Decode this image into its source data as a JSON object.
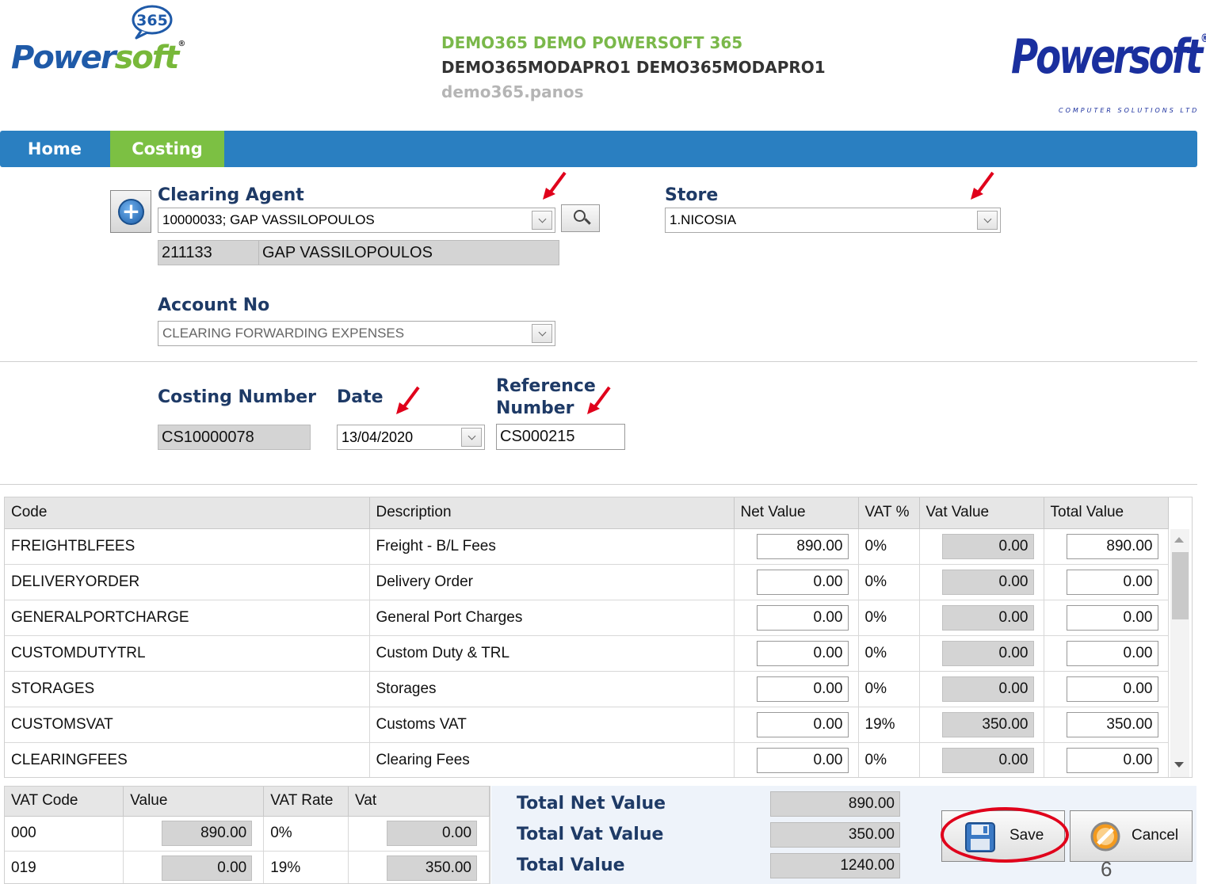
{
  "header": {
    "logo_left_text_a": "Power",
    "logo_left_text_b": "soft",
    "logo_left_badge": "365",
    "company_line": "DEMO365 DEMO POWERSOFT 365",
    "database_line": "DEMO365MODAPRO1 DEMO365MODAPRO1",
    "user_line": "demo365.panos",
    "logo_right_text": "Powersoft",
    "logo_right_subtitle": "COMPUTER SOLUTIONS LTD"
  },
  "nav": {
    "tabs": [
      {
        "label": "Home",
        "active": false
      },
      {
        "label": "Costing",
        "active": true
      }
    ]
  },
  "form": {
    "clearing_agent_label": "Clearing Agent",
    "clearing_agent_value": "10000033; GAP VASSILOPOULOS",
    "agent_code": "211133",
    "agent_name": "GAP VASSILOPOULOS",
    "store_label": "Store",
    "store_value": "1.NICOSIA",
    "account_no_label": "Account No",
    "account_no_value": "CLEARING  FORWARDING EXPENSES",
    "costing_number_label": "Costing Number",
    "costing_number_value": "CS10000078",
    "date_label": "Date",
    "date_value": "13/04/2020",
    "reference_label_1": "Reference",
    "reference_label_2": "Number",
    "reference_value": "CS000215"
  },
  "grid": {
    "columns": [
      "Code",
      "Description",
      "Net Value",
      "VAT %",
      "Vat Value",
      "Total Value"
    ],
    "rows": [
      {
        "code": "FREIGHTBLFEES",
        "description": "Freight - B/L Fees",
        "net": "890.00",
        "vat_pct": "0%",
        "vat_value": "0.00",
        "total": "890.00"
      },
      {
        "code": "DELIVERYORDER",
        "description": "Delivery Order",
        "net": "0.00",
        "vat_pct": "0%",
        "vat_value": "0.00",
        "total": "0.00"
      },
      {
        "code": "GENERALPORTCHARGE",
        "description": "General Port Charges",
        "net": "0.00",
        "vat_pct": "0%",
        "vat_value": "0.00",
        "total": "0.00"
      },
      {
        "code": "CUSTOMDUTYTRL",
        "description": "Custom Duty & TRL",
        "net": "0.00",
        "vat_pct": "0%",
        "vat_value": "0.00",
        "total": "0.00"
      },
      {
        "code": "STORAGES",
        "description": "Storages",
        "net": "0.00",
        "vat_pct": "0%",
        "vat_value": "0.00",
        "total": "0.00"
      },
      {
        "code": "CUSTOMSVAT",
        "description": "Customs VAT",
        "net": "0.00",
        "vat_pct": "19%",
        "vat_value": "350.00",
        "total": "350.00"
      },
      {
        "code": "CLEARINGFEES",
        "description": "Clearing Fees",
        "net": "0.00",
        "vat_pct": "0%",
        "vat_value": "0.00",
        "total": "0.00"
      }
    ]
  },
  "vat_table": {
    "columns": [
      "VAT Code",
      "Value",
      "VAT Rate",
      "Vat"
    ],
    "rows": [
      {
        "code": "000",
        "value": "890.00",
        "rate": "0%",
        "vat": "0.00"
      },
      {
        "code": "019",
        "value": "0.00",
        "rate": "19%",
        "vat": "350.00"
      }
    ]
  },
  "totals": {
    "net_label": "Total Net Value",
    "net_value": "890.00",
    "vat_label": "Total Vat Value",
    "vat_value": "350.00",
    "total_label": "Total Value",
    "total_value": "1240.00"
  },
  "actions": {
    "save_label": "Save",
    "cancel_label": "Cancel"
  },
  "page_number": "6",
  "colors": {
    "nav_blue": "#2a7fc1",
    "nav_active_green": "#7cc043",
    "label_navy": "#1e3a66",
    "annotation_red": "#e0001b"
  }
}
